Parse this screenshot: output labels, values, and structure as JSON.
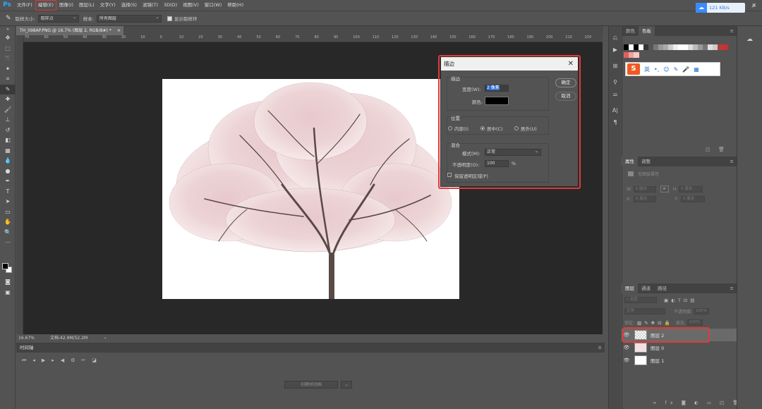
{
  "app": {
    "logo": "Ps"
  },
  "menu": [
    "文件(F)",
    "编辑(E)",
    "图像(I)",
    "图层(L)",
    "文字(Y)",
    "选择(S)",
    "滤镜(T)",
    "3D(D)",
    "视图(V)",
    "窗口(W)",
    "帮助(H)"
  ],
  "window_controls": {
    "min": "—",
    "max": "▭",
    "close": "✕"
  },
  "options": {
    "sample_size_label": "取样大小:",
    "sample_size_value": "取样点",
    "sample_label": "样本:",
    "sample_value": "所有图层",
    "show_ring_label": "显示取样环",
    "net_speed": "121 KB/s"
  },
  "document": {
    "tab_label": "TH_098AP.PNG @ 16.7% (图层 2, RGB/8#) *",
    "zoom": "16.67%",
    "doc_size": "文档:42.9M/52.2M",
    "ruler_ticks": [
      "70",
      "60",
      "50",
      "40",
      "30",
      "20",
      "10",
      "0",
      "10",
      "20",
      "30",
      "40",
      "50",
      "60",
      "70",
      "80",
      "90",
      "100",
      "110",
      "120",
      "130",
      "140",
      "150",
      "160",
      "170",
      "180",
      "190",
      "200",
      "210",
      "220"
    ]
  },
  "timeline": {
    "title": "时间轴",
    "create_button": "创建帧动画"
  },
  "panels": {
    "color_tabs": [
      "颜色",
      "色板"
    ],
    "props_tabs": [
      "属性",
      "调整"
    ],
    "props_empty": "无图层属性",
    "props_fields": {
      "w": "W:",
      "h": "H:",
      "x": "X:",
      "y": "Y:",
      "w_val": "0 厘米",
      "h_val": "0 厘米",
      "x_val": "0 厘米",
      "y_val": "0 厘米"
    },
    "layers_tabs": [
      "图层",
      "通道",
      "路径"
    ],
    "layers_search": "类型",
    "blend_mode": "正常",
    "opacity_label": "不透明度:",
    "opacity_value": "100%",
    "lock_label": "锁定:",
    "fill_label": "填充:",
    "fill_value": "100%",
    "layers": [
      {
        "name": "图层 2",
        "selected": true
      },
      {
        "name": "图层 0",
        "selected": false
      },
      {
        "name": "图层 1",
        "selected": false
      }
    ]
  },
  "ime": {
    "logo": "S",
    "lang": "英"
  },
  "stroke_dialog": {
    "title": "描边",
    "stroke_group": "描边",
    "width_label": "宽度(W):",
    "width_value": "2 像素",
    "color_label": "颜色:",
    "position_group": "位置",
    "positions": [
      "内部(I)",
      "居中(C)",
      "居外(U)"
    ],
    "position_selected": "居中(C)",
    "blend_group": "混合",
    "mode_label": "模式(M):",
    "mode_value": "正常",
    "opacity_label": "不透明度(O):",
    "opacity_value": "100",
    "opacity_unit": "%",
    "preserve_label": "保留透明区域(P)",
    "ok": "确定",
    "cancel": "取消"
  }
}
